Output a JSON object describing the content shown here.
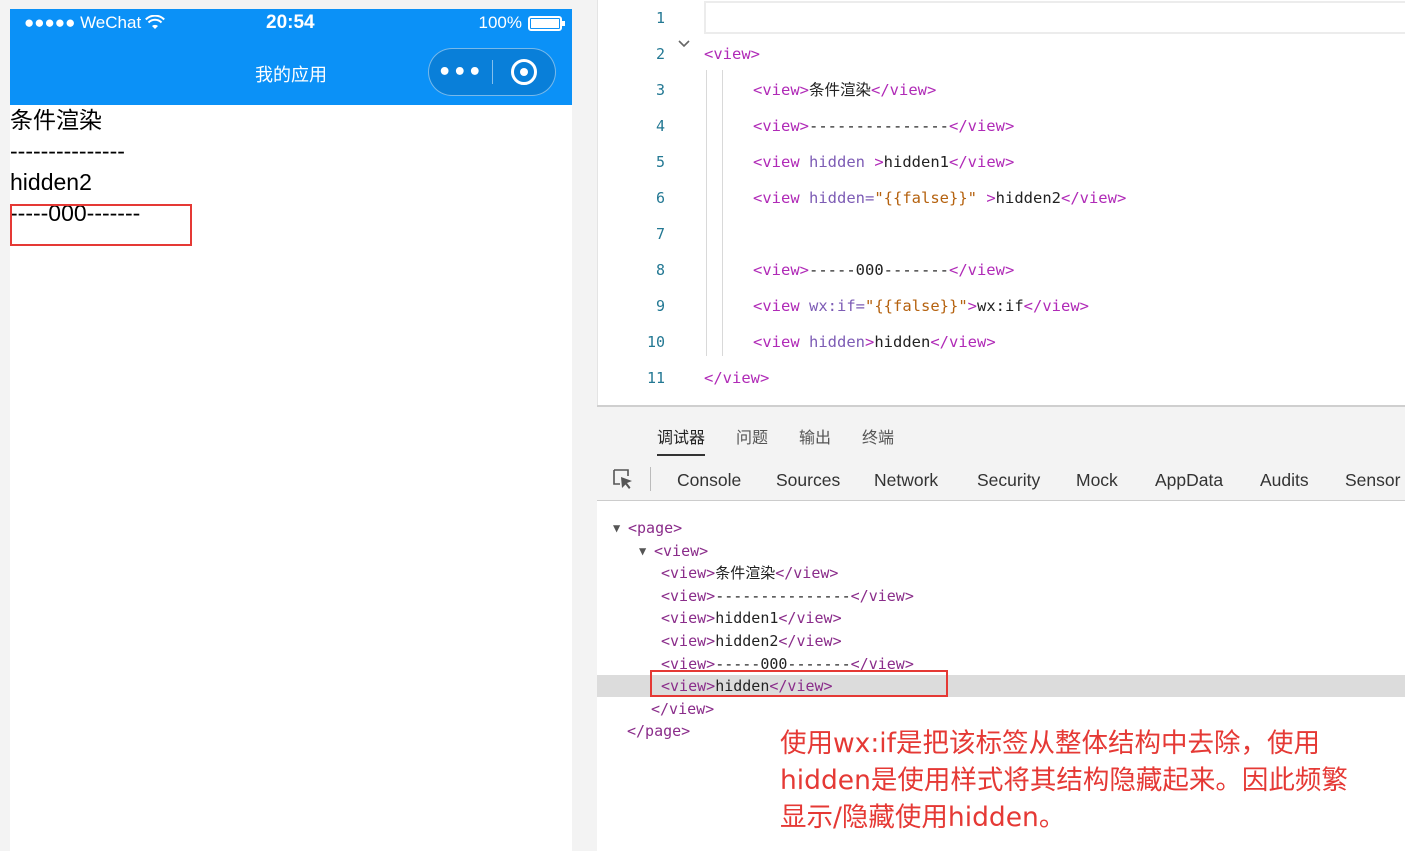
{
  "phone": {
    "status_carrier": "●●●●● WeChat",
    "status_time": "20:54",
    "status_battery": "100%",
    "nav_title": "我的应用",
    "capsule_more": "•••",
    "content_lines": [
      "条件渲染",
      "---------------",
      "hidden2",
      "-----000-------"
    ]
  },
  "editor": {
    "lines": [
      {
        "n": "1",
        "parts": []
      },
      {
        "n": "2",
        "parts": [
          [
            "t-tag",
            "<view>"
          ]
        ]
      },
      {
        "n": "3",
        "parts": [
          [
            "t-tag",
            "<view>"
          ],
          [
            "t-text",
            "条件渲染"
          ],
          [
            "t-tag",
            "</view>"
          ]
        ]
      },
      {
        "n": "4",
        "parts": [
          [
            "t-tag",
            "<view>"
          ],
          [
            "t-text",
            "---------------"
          ],
          [
            "t-tag",
            "</view>"
          ]
        ]
      },
      {
        "n": "5",
        "parts": [
          [
            "t-tag",
            "<view "
          ],
          [
            "t-attr",
            "hidden"
          ],
          [
            "t-tag",
            " >"
          ],
          [
            "t-text",
            "hidden1"
          ],
          [
            "t-tag",
            "</view>"
          ]
        ]
      },
      {
        "n": "6",
        "parts": [
          [
            "t-tag",
            "<view "
          ],
          [
            "t-attr",
            "hidden="
          ],
          [
            "t-str",
            "\"{{false}}\""
          ],
          [
            "t-tag",
            " >"
          ],
          [
            "t-text",
            "hidden2"
          ],
          [
            "t-tag",
            "</view>"
          ]
        ]
      },
      {
        "n": "7",
        "parts": []
      },
      {
        "n": "8",
        "parts": [
          [
            "t-tag",
            "<view>"
          ],
          [
            "t-text",
            "-----000-------"
          ],
          [
            "t-tag",
            "</view>"
          ]
        ]
      },
      {
        "n": "9",
        "parts": [
          [
            "t-tag",
            "<view "
          ],
          [
            "t-attr",
            "wx:if="
          ],
          [
            "t-str",
            "\"{{false}}\""
          ],
          [
            "t-tag",
            ">"
          ],
          [
            "t-text",
            "wx:if"
          ],
          [
            "t-tag",
            "</view>"
          ]
        ]
      },
      {
        "n": "10",
        "parts": [
          [
            "t-tag",
            "<view "
          ],
          [
            "t-attr",
            "hidden"
          ],
          [
            "t-tag",
            ">"
          ],
          [
            "t-text",
            "hidden"
          ],
          [
            "t-tag",
            "</view>"
          ]
        ]
      },
      {
        "n": "11",
        "parts": [
          [
            "t-tag",
            "</view>"
          ]
        ]
      }
    ]
  },
  "devtools": {
    "top_tabs": [
      "调试器",
      "问题",
      "输出",
      "终端"
    ],
    "panel_tabs": [
      "Console",
      "Sources",
      "Network",
      "Security",
      "Mock",
      "AppData",
      "Audits",
      "Sensor"
    ],
    "dom": [
      {
        "tri": "▼",
        "indent": 0,
        "parts": [
          [
            "d-tag",
            "<page>"
          ]
        ]
      },
      {
        "tri": "▼",
        "indent": 1,
        "parts": [
          [
            "d-tag",
            "<view>"
          ]
        ]
      },
      {
        "tri": "",
        "indent": 2,
        "parts": [
          [
            "d-tag",
            "<view>"
          ],
          [
            "d-text",
            "条件渲染"
          ],
          [
            "d-tag",
            "</view>"
          ]
        ]
      },
      {
        "tri": "",
        "indent": 2,
        "parts": [
          [
            "d-tag",
            "<view>"
          ],
          [
            "d-text",
            "---------------"
          ],
          [
            "d-tag",
            "</view>"
          ]
        ]
      },
      {
        "tri": "",
        "indent": 2,
        "parts": [
          [
            "d-tag",
            "<view>"
          ],
          [
            "d-text",
            "hidden1"
          ],
          [
            "d-tag",
            "</view>"
          ]
        ]
      },
      {
        "tri": "",
        "indent": 2,
        "parts": [
          [
            "d-tag",
            "<view>"
          ],
          [
            "d-text",
            "hidden2"
          ],
          [
            "d-tag",
            "</view>"
          ]
        ]
      },
      {
        "tri": "",
        "indent": 2,
        "parts": [
          [
            "d-tag",
            "<view>"
          ],
          [
            "d-text",
            "-----000-------"
          ],
          [
            "d-tag",
            "</view>"
          ]
        ]
      },
      {
        "tri": "",
        "indent": 2,
        "sel": true,
        "parts": [
          [
            "d-tag",
            "<view>"
          ],
          [
            "d-text",
            "hidden"
          ],
          [
            "d-tag",
            "</view>"
          ]
        ]
      },
      {
        "tri": "",
        "indent": 1,
        "parts": [
          [
            "d-tag",
            "</view>"
          ]
        ]
      },
      {
        "tri": "",
        "indent": 0,
        "parts": [
          [
            "d-tag",
            "</page>"
          ]
        ]
      }
    ]
  },
  "note": {
    "lines": [
      "使用wx:if是把该标签从整体结构中去除，使用",
      "hidden是使用样式将其结构隐藏起来。因此频繁",
      "显示/隐藏使用hidden。"
    ]
  },
  "colors": {
    "navbar": "#0b91f7",
    "annotation": "#e53935",
    "tag": "#b02ab7"
  }
}
